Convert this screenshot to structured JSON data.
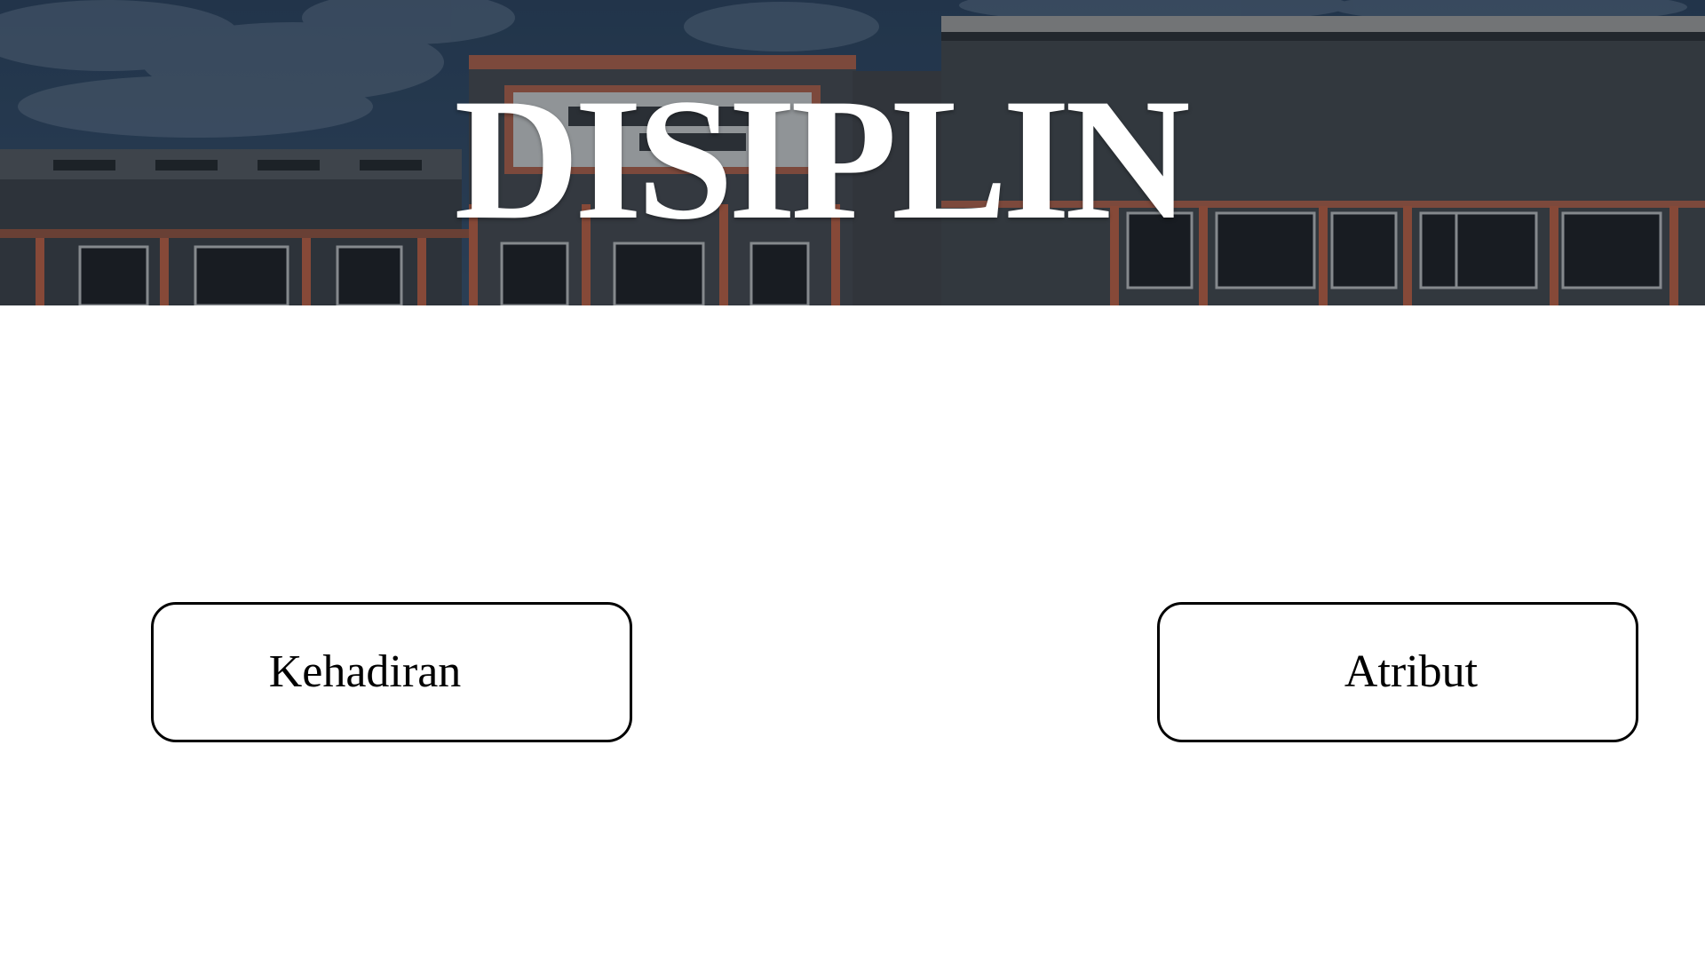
{
  "banner": {
    "title": "DISIPLIN",
    "image_description_icon": "school-building-photo"
  },
  "buttons": [
    {
      "label": "Kehadiran"
    },
    {
      "label": "Atribut"
    }
  ],
  "colors": {
    "banner_overlay": "#16202b",
    "sky": "#3e5673",
    "building_wall": "#4a5058",
    "trim_orange": "#c8674a",
    "text_light": "#ffffff",
    "button_border": "#000000"
  }
}
